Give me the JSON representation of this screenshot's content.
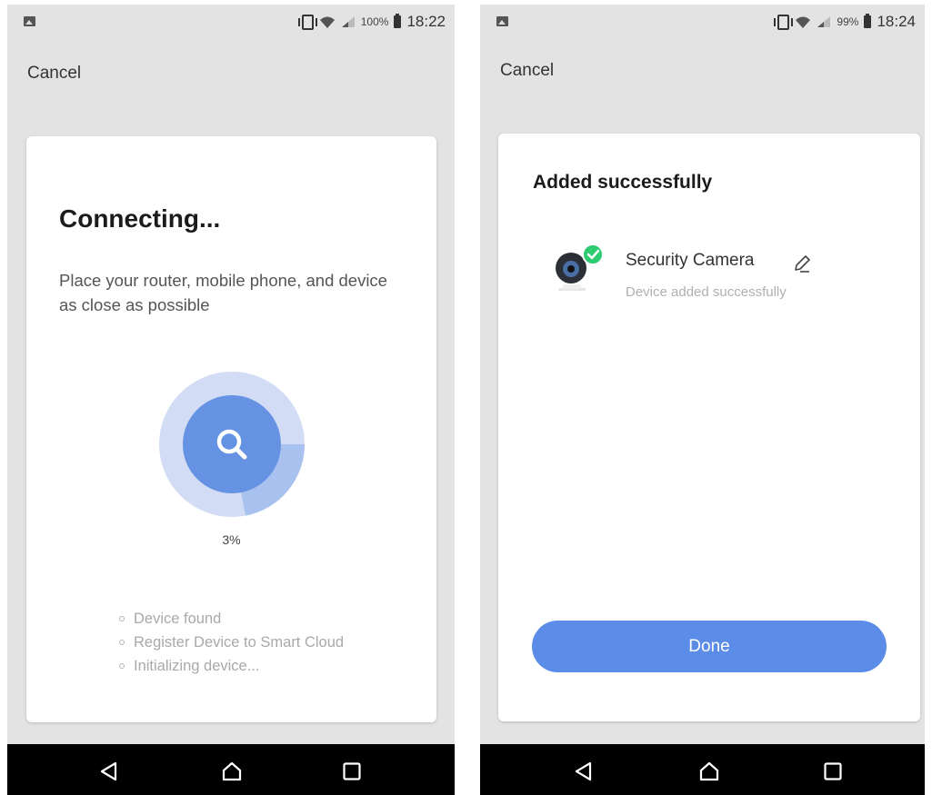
{
  "left_screen": {
    "status_bar": {
      "battery_percent": "100%",
      "time": "18:22"
    },
    "cancel_label": "Cancel",
    "title": "Connecting...",
    "description": "Place your router, mobile phone, and device as close as possible",
    "progress": {
      "percent_label": "3%",
      "fraction": 0.03
    },
    "steps": [
      "Device found",
      "Register Device to Smart Cloud",
      "Initializing device..."
    ],
    "icons": {
      "progress": "search-icon"
    }
  },
  "right_screen": {
    "status_bar": {
      "battery_percent": "99%",
      "time": "18:24"
    },
    "cancel_label": "Cancel",
    "title": "Added successfully",
    "device": {
      "name": "Security Camera",
      "status": "Device added successfully"
    },
    "done_label": "Done",
    "icons": {
      "device": "security-camera-icon",
      "badge": "check-badge-icon",
      "edit": "pencil-icon"
    }
  },
  "colors": {
    "accent": "#5b8de8",
    "success": "#2ecc71",
    "background": "#e3e3e3",
    "nav_bar": "#000000"
  }
}
